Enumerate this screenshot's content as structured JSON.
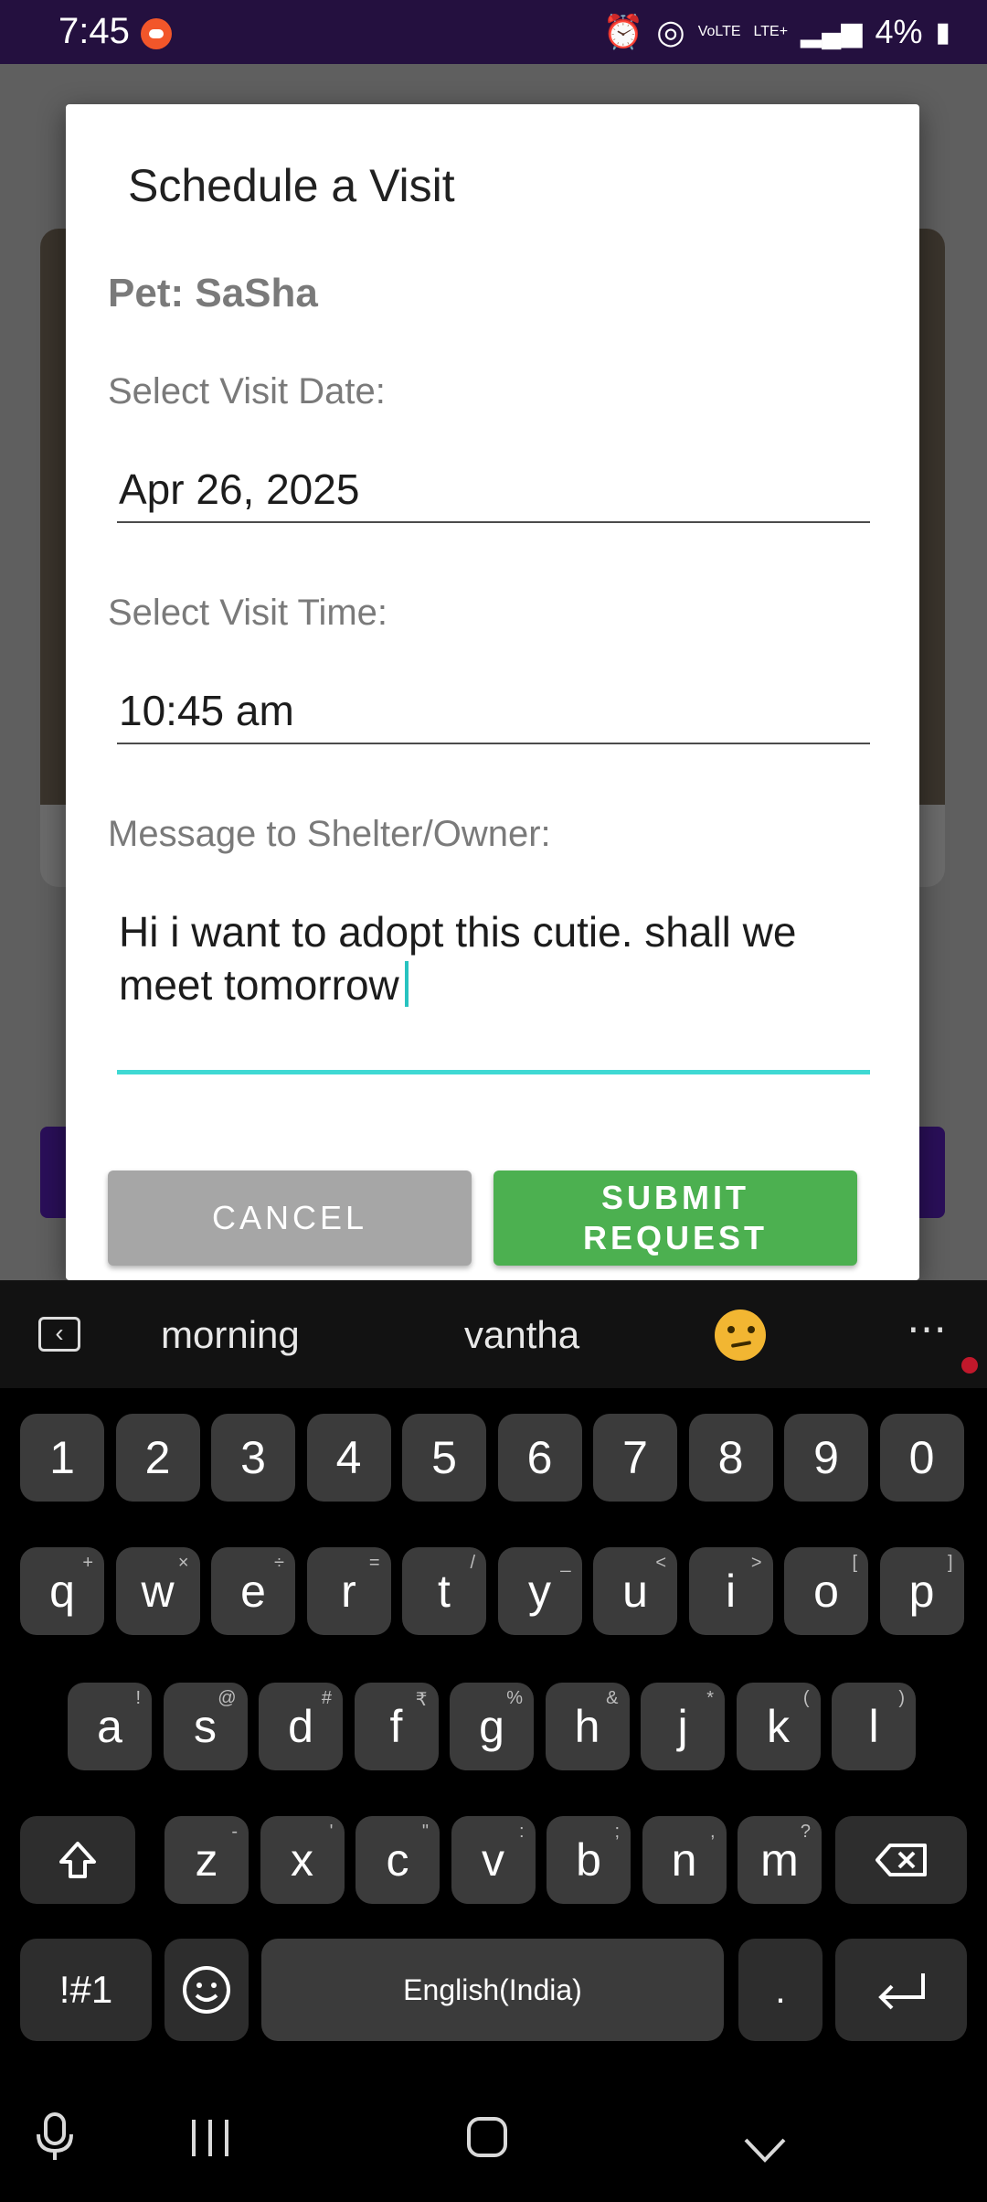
{
  "status_bar": {
    "time": "7:45",
    "battery": "4%",
    "icons": [
      "recording-app-icon",
      "alarm-icon",
      "hotspot-icon",
      "volte-icon",
      "lte-icon",
      "signal-icon",
      "battery-charging-icon"
    ],
    "volte_label": "VoLTE",
    "lte_label": "LTE+"
  },
  "dialog": {
    "title": "Schedule a Visit",
    "pet_label": "Pet: SaSha",
    "date_label": "Select Visit Date:",
    "date_value": "Apr 26, 2025",
    "time_label": "Select Visit Time:",
    "time_value": "10:45 am",
    "message_label": "Message to Shelter/Owner:",
    "message_value": "Hi i want to adopt this cutie. shall we meet tomorrow",
    "cancel_label": "CANCEL",
    "submit_label_line1": "SUBMIT",
    "submit_label_line2": "REQUEST",
    "accent_color": "#3fd9d3",
    "submit_color": "#4cb050",
    "cancel_color": "#a6a6a6"
  },
  "keyboard": {
    "suggestions": [
      "morning",
      "vantha"
    ],
    "suggestion_emoji": "thinking-face-emoji",
    "number_row": [
      "1",
      "2",
      "3",
      "4",
      "5",
      "6",
      "7",
      "8",
      "9",
      "0"
    ],
    "row1": [
      {
        "k": "q",
        "s": "+"
      },
      {
        "k": "w",
        "s": "×"
      },
      {
        "k": "e",
        "s": "÷"
      },
      {
        "k": "r",
        "s": "="
      },
      {
        "k": "t",
        "s": "/"
      },
      {
        "k": "y",
        "s": "_"
      },
      {
        "k": "u",
        "s": "<"
      },
      {
        "k": "i",
        "s": ">"
      },
      {
        "k": "o",
        "s": "["
      },
      {
        "k": "p",
        "s": "]"
      }
    ],
    "row2": [
      {
        "k": "a",
        "s": "!"
      },
      {
        "k": "s",
        "s": "@"
      },
      {
        "k": "d",
        "s": "#"
      },
      {
        "k": "f",
        "s": "₹"
      },
      {
        "k": "g",
        "s": "%"
      },
      {
        "k": "h",
        "s": "&"
      },
      {
        "k": "j",
        "s": "*"
      },
      {
        "k": "k",
        "s": "("
      },
      {
        "k": "l",
        "s": ")"
      }
    ],
    "row3": [
      {
        "k": "z",
        "s": "-"
      },
      {
        "k": "x",
        "s": "'"
      },
      {
        "k": "c",
        "s": "\""
      },
      {
        "k": "v",
        "s": ":"
      },
      {
        "k": "b",
        "s": ";"
      },
      {
        "k": "n",
        "s": ","
      },
      {
        "k": "m",
        "s": "?"
      }
    ],
    "symbols_label": "!#1",
    "space_label": "English(India)",
    "period_label": "."
  }
}
